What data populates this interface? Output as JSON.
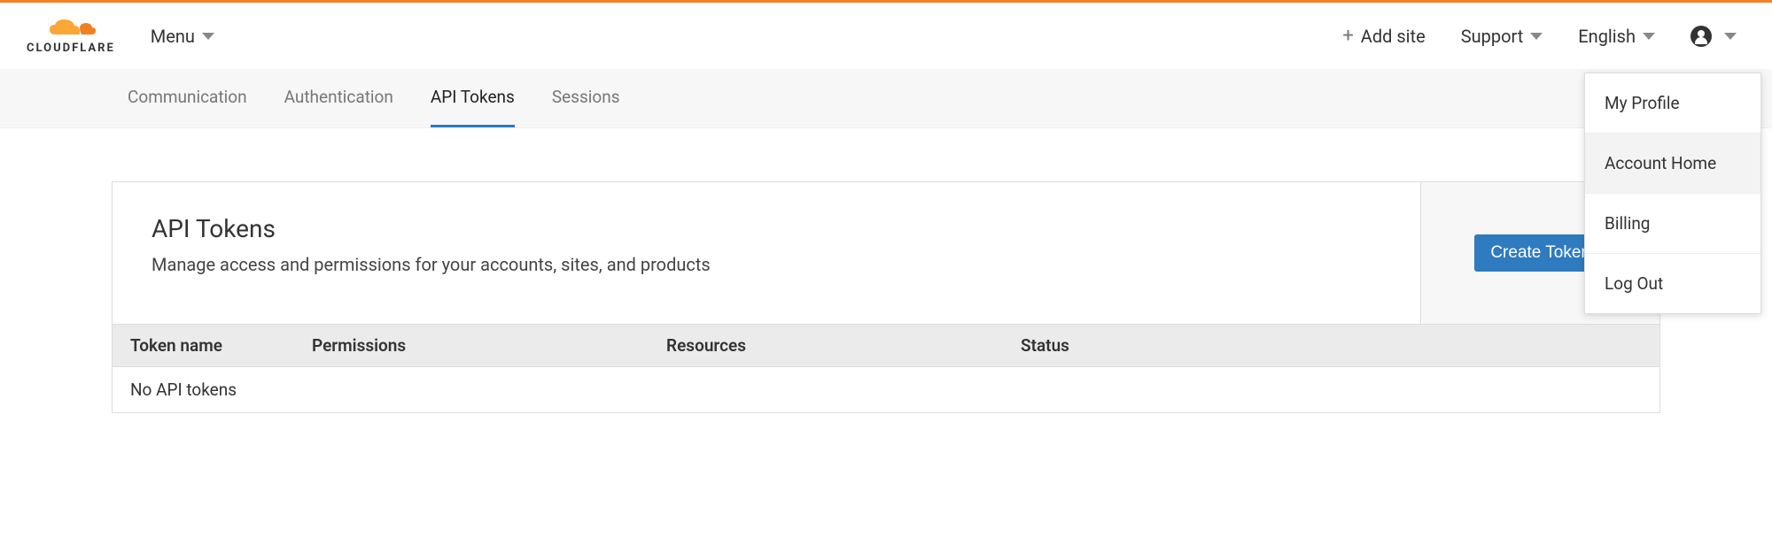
{
  "brand": "CLOUDFLARE",
  "header": {
    "menu_label": "Menu",
    "add_site_label": "Add site",
    "support_label": "Support",
    "language_label": "English"
  },
  "tabs": {
    "items": [
      {
        "label": "Communication",
        "active": false
      },
      {
        "label": "Authentication",
        "active": false
      },
      {
        "label": "API Tokens",
        "active": true
      },
      {
        "label": "Sessions",
        "active": false
      }
    ]
  },
  "dropdown": {
    "items": [
      {
        "label": "My Profile",
        "hover": false
      },
      {
        "label": "Account Home",
        "hover": true
      },
      {
        "label": "Billing",
        "hover": false
      },
      {
        "label": "Log Out",
        "hover": false
      }
    ]
  },
  "main": {
    "title": "API Tokens",
    "subtitle": "Manage access and permissions for your accounts, sites, and products",
    "create_button": "Create Token",
    "columns": {
      "name": "Token name",
      "permissions": "Permissions",
      "resources": "Resources",
      "status": "Status"
    },
    "empty_row": "No API tokens"
  }
}
